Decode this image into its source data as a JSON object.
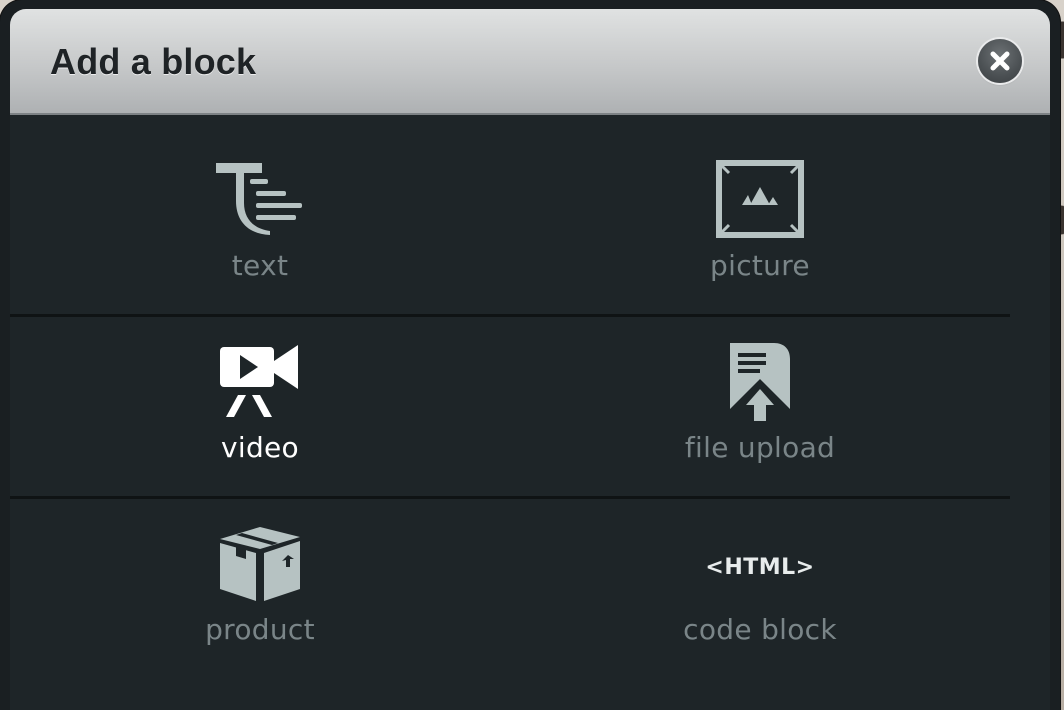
{
  "dialog": {
    "title": "Add a block",
    "close_icon": "close-icon"
  },
  "blocks": [
    {
      "label": "text",
      "icon": "text-block-icon",
      "active": false
    },
    {
      "label": "picture",
      "icon": "picture-icon",
      "active": false
    },
    {
      "label": "video",
      "icon": "video-camera-icon",
      "active": true
    },
    {
      "label": "file upload",
      "icon": "file-upload-icon",
      "active": false
    },
    {
      "label": "product",
      "icon": "product-box-icon",
      "active": false
    },
    {
      "label": "code block",
      "icon": "html-code-icon",
      "active": false,
      "glyph": "<HTML>"
    }
  ],
  "colors": {
    "header_top": "#e0e2e2",
    "header_bottom": "#aeb1b3",
    "body_bg": "#1e2528",
    "icon_muted": "#b6c2c2",
    "label_muted": "#7a8588",
    "label_active": "#ffffff"
  }
}
